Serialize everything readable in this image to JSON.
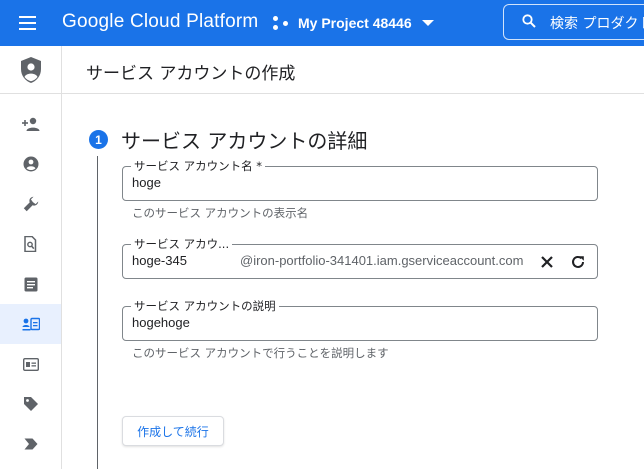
{
  "topbar": {
    "product_title": "Google Cloud Platform",
    "project_name": "My Project 48446",
    "search_placeholder": "検索  プロダクト"
  },
  "colors": {
    "brand_blue": "#1a73e8",
    "rail_active_bg": "#e8f0fe",
    "border": "#80868b",
    "hint_text": "#5f6368"
  },
  "rail": {
    "header_icon": "shield-person-icon",
    "items": [
      {
        "icon": "person-add-icon",
        "active": false
      },
      {
        "icon": "account-circle-icon",
        "active": false
      },
      {
        "icon": "wrench-icon",
        "active": false
      },
      {
        "icon": "document-search-icon",
        "active": false
      },
      {
        "icon": "notes-icon",
        "active": false
      },
      {
        "icon": "service-account-icon",
        "active": true
      },
      {
        "icon": "id-card-icon",
        "active": false
      },
      {
        "icon": "tag-icon",
        "active": false
      },
      {
        "icon": "chevron-label-icon",
        "active": false
      }
    ]
  },
  "page": {
    "title": "サービス アカウントの作成"
  },
  "step": {
    "number": "1",
    "title": "サービス アカウントの詳細"
  },
  "form": {
    "name": {
      "label": "サービス アカウント名 *",
      "value": "hoge",
      "hint": "このサービス アカウントの表示名"
    },
    "id": {
      "label": "サービス アカウ...",
      "value": "hoge-345",
      "suffix": "@iron-portfolio-341401.iam.gserviceaccount.com"
    },
    "description": {
      "label": "サービス アカウントの説明",
      "value": "hogehoge",
      "hint": "このサービス アカウントで行うことを説明します"
    },
    "create_button_label": "作成して続行"
  }
}
